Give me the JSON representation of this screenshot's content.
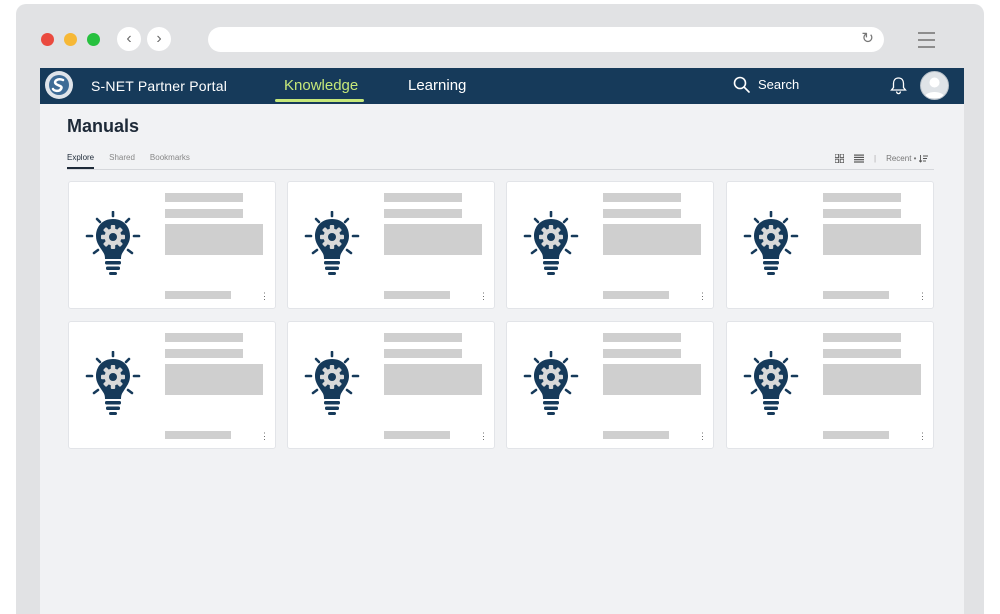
{
  "browser": {
    "back_icon": "chevron-left-icon",
    "forward_icon": "chevron-right-icon",
    "reload_icon": "reload-icon",
    "menu_icon": "hamburger-icon",
    "traffic_colors": [
      "#ea4a3f",
      "#f6b836",
      "#27c13f"
    ]
  },
  "header": {
    "brand": "S-NET Partner Portal",
    "nav": [
      {
        "label": "Knowledge",
        "active": true
      },
      {
        "label": "Learning",
        "active": false
      }
    ],
    "search_label": "Search",
    "accent_color": "#c6e87a",
    "bar_color": "#163a5a"
  },
  "page": {
    "title": "Manuals",
    "tabs": [
      {
        "label": "Explore",
        "active": true
      },
      {
        "label": "Shared",
        "active": false
      },
      {
        "label": "Bookmarks",
        "active": false
      }
    ],
    "sort_label": "Recent •",
    "view_icons": [
      "grid-view-icon",
      "list-view-icon"
    ]
  },
  "cards": [
    {
      "icon": "lightbulb-gear-icon"
    },
    {
      "icon": "lightbulb-gear-icon"
    },
    {
      "icon": "lightbulb-gear-icon"
    },
    {
      "icon": "lightbulb-gear-icon"
    },
    {
      "icon": "lightbulb-gear-icon"
    },
    {
      "icon": "lightbulb-gear-icon"
    },
    {
      "icon": "lightbulb-gear-icon"
    },
    {
      "icon": "lightbulb-gear-icon"
    }
  ]
}
